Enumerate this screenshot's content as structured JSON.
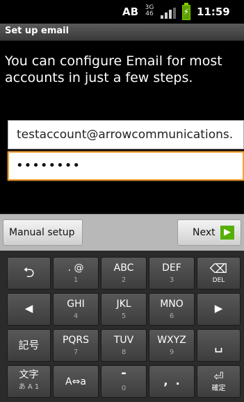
{
  "status_bar": {
    "input_mode": "AB",
    "network_top": "3G",
    "network_bottom": "46",
    "battery_icon": "battery-charging-icon",
    "time": "11:59"
  },
  "header": {
    "title": "Set up email"
  },
  "intro_text": "You can configure Email for most accounts in just a few steps.",
  "form": {
    "email_value": "testaccount@arrowcommunications.",
    "password_value": "••••••••"
  },
  "buttons": {
    "manual_setup": "Manual setup",
    "next": "Next",
    "next_icon": "arrow-right-icon",
    "next_icon_color": "#55b000"
  },
  "keyboard": {
    "row1": [
      {
        "icon": "undo-icon",
        "glyph": "⮌"
      },
      {
        "main": ". @",
        "sub": "1"
      },
      {
        "main": "ABC",
        "sub": "2"
      },
      {
        "main": "DEF",
        "sub": "3"
      },
      {
        "icon": "delete-icon",
        "glyph": "⌫",
        "sub": "DEL"
      }
    ],
    "row2": [
      {
        "icon": "cursor-left-icon",
        "glyph": "◀"
      },
      {
        "main": "GHI",
        "sub": "4"
      },
      {
        "main": "JKL",
        "sub": "5"
      },
      {
        "main": "MNO",
        "sub": "6"
      },
      {
        "icon": "cursor-right-icon",
        "glyph": "▶"
      }
    ],
    "row3": [
      {
        "main": "記号"
      },
      {
        "main": "PQRS",
        "sub": "7"
      },
      {
        "main": "TUV",
        "sub": "8"
      },
      {
        "main": "WXYZ",
        "sub": "9"
      },
      {
        "icon": "space-icon",
        "glyph": "␣"
      }
    ],
    "row4": [
      {
        "main": "文字",
        "sub": "あ A 1"
      },
      {
        "main": "A⇔a"
      },
      {
        "main": "-",
        "sub": "0"
      },
      {
        "main": ",  ."
      },
      {
        "icon": "enter-icon",
        "glyph": "⏎",
        "sub": "確定"
      }
    ]
  }
}
